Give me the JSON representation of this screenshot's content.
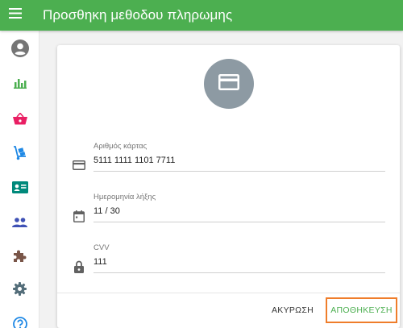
{
  "appbar": {
    "title": "Προσθηκη μεθοδου πληρωμης",
    "menu_icon": "hamburger-menu-icon",
    "color": "#4caf50"
  },
  "sidebar": {
    "items": [
      {
        "name": "account-icon",
        "color": "#757575"
      },
      {
        "name": "bar-chart-icon",
        "color": "#4caf50"
      },
      {
        "name": "shopping-basket-icon",
        "color": "#e91e63"
      },
      {
        "name": "hand-truck-icon",
        "color": "#1e88e5"
      },
      {
        "name": "contact-card-icon",
        "color": "#00897b"
      },
      {
        "name": "people-icon",
        "color": "#3f51b5"
      },
      {
        "name": "puzzle-icon",
        "color": "#795548"
      },
      {
        "name": "gear-icon",
        "color": "#546e7a"
      },
      {
        "name": "help-icon",
        "color": "#1e88e5"
      }
    ]
  },
  "card": {
    "avatar_icon": "credit-card-icon",
    "avatar_color": "#8d9aa3",
    "fields": {
      "card_number": {
        "label": "Αριθμός κάρτας",
        "value": "5111 1111 1101 7711",
        "icon": "credit-card-icon"
      },
      "expiry": {
        "label": "Ημερομηνία λήξης",
        "value": "11 / 30",
        "icon": "calendar-icon"
      },
      "cvv": {
        "label": "CVV",
        "value": "111",
        "icon": "lock-icon"
      }
    },
    "actions": {
      "cancel_label": "ΑΚΥΡΩΣΗ",
      "save_label": "ΑΠΟΘΗΚΕΥΣΗ",
      "save_color": "#4caf50",
      "highlight_color": "#ef7d2b"
    }
  }
}
